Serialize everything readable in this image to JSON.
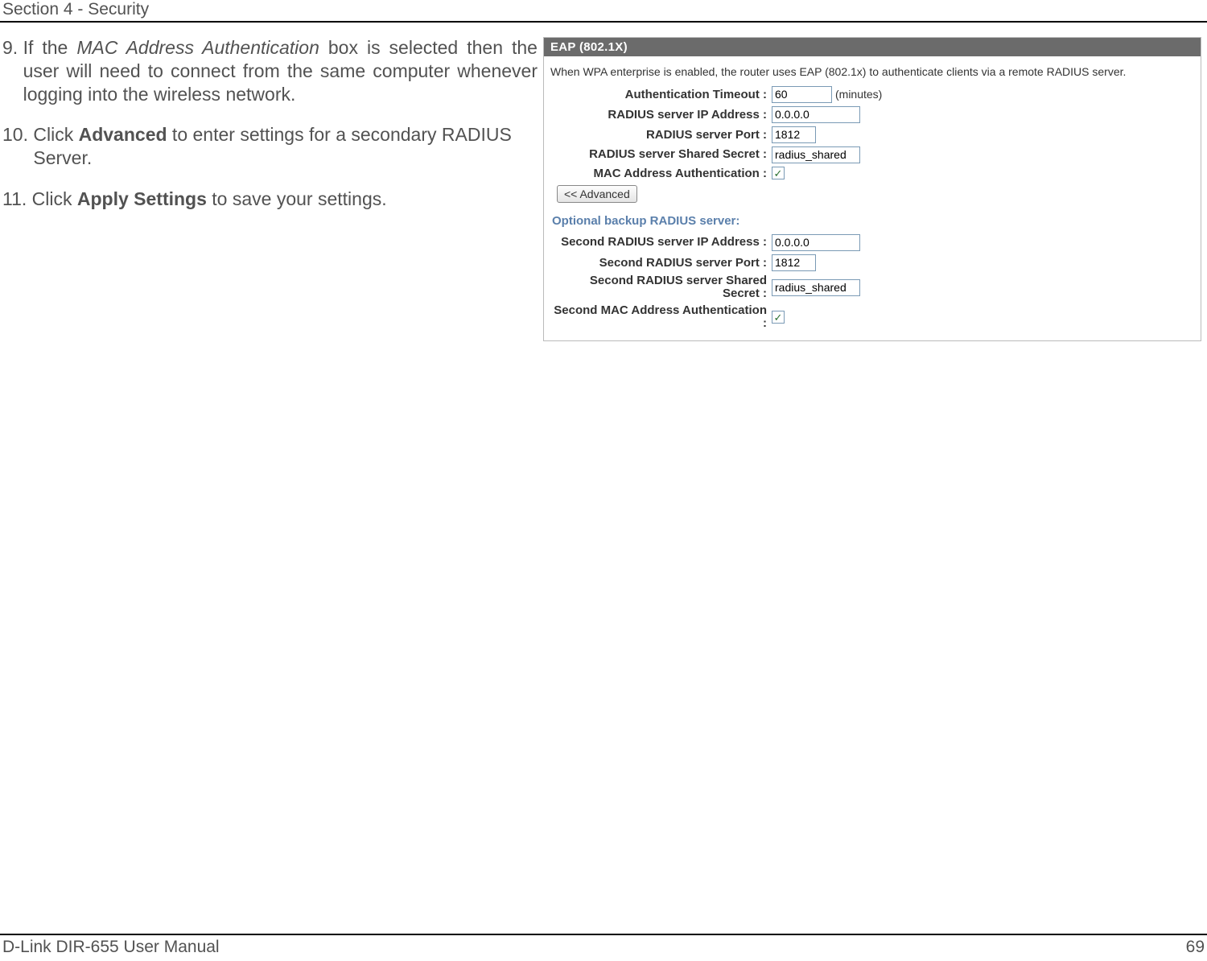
{
  "header": {
    "section": "Section 4 - Security"
  },
  "steps": {
    "s9": {
      "num": "9. ",
      "pre": "If the ",
      "italic": "MAC Address Authentication",
      "post": " box is selected then the user will need to connect from the same computer whenever logging into the wireless network."
    },
    "s10": {
      "num": "10. ",
      "pre": "Click ",
      "bold": "Advanced",
      "post": " to enter settings for a secondary RADIUS Server."
    },
    "s11": {
      "num": "11. ",
      "pre": "Click ",
      "bold": "Apply Settings",
      "post": " to save your settings."
    }
  },
  "panel": {
    "title": "EAP (802.1X)",
    "desc": "When WPA enterprise is enabled, the router uses EAP (802.1x) to authenticate clients via a remote RADIUS server.",
    "auth_timeout": {
      "label": "Authentication Timeout :",
      "value": "60",
      "unit": "(minutes)"
    },
    "radius_ip": {
      "label": "RADIUS server IP Address :",
      "value": "0.0.0.0"
    },
    "radius_port": {
      "label": "RADIUS server Port :",
      "value": "1812"
    },
    "radius_secret": {
      "label": "RADIUS server Shared Secret :",
      "value": "radius_shared"
    },
    "mac_auth": {
      "label": "MAC Address Authentication :",
      "checked": true
    },
    "advanced_btn": "<< Advanced",
    "backup_header": "Optional backup RADIUS server:",
    "second_ip": {
      "label": "Second RADIUS server IP Address :",
      "value": "0.0.0.0"
    },
    "second_port": {
      "label": "Second RADIUS server Port :",
      "value": "1812"
    },
    "second_secret": {
      "label": "Second RADIUS server Shared Secret :",
      "value": "radius_shared"
    },
    "second_mac": {
      "label": "Second MAC Address Authentication :",
      "checked": true
    }
  },
  "footer": {
    "left": "D-Link DIR-655 User Manual",
    "right": "69"
  }
}
